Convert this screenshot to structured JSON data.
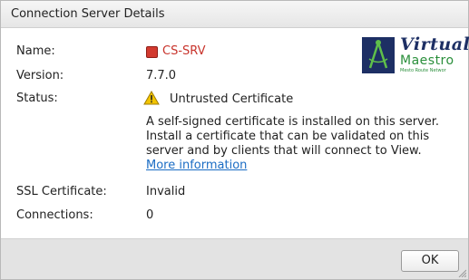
{
  "window": {
    "title": "Connection Server Details"
  },
  "fields": {
    "name_label": "Name:",
    "name_value": "CS-SRV",
    "version_label": "Version:",
    "version_value": "7.7.0",
    "status_label": "Status:",
    "status_value": "Untrusted Certificate",
    "status_description": "A self-signed certificate is installed on this server. Install a certificate that can be validated on this server and by clients that will connect to View.",
    "more_info_link": "More information",
    "ssl_label": "SSL Certificate:",
    "ssl_value": "Invalid",
    "connections_label": "Connections:",
    "connections_value": "0"
  },
  "logo": {
    "line1": "Virtual",
    "line2": "Maestro",
    "tagline": "Mesto   Route   Networ"
  },
  "footer": {
    "ok_label": "OK"
  },
  "colors": {
    "server_status": "#d23a2f",
    "link": "#1a6cc4",
    "warning": "#f2c400",
    "logo_primary": "#1d2f64",
    "logo_secondary": "#2a8f3b"
  },
  "icons": {
    "server_status": "red-square-status-icon",
    "status": "warning-triangle-icon"
  }
}
